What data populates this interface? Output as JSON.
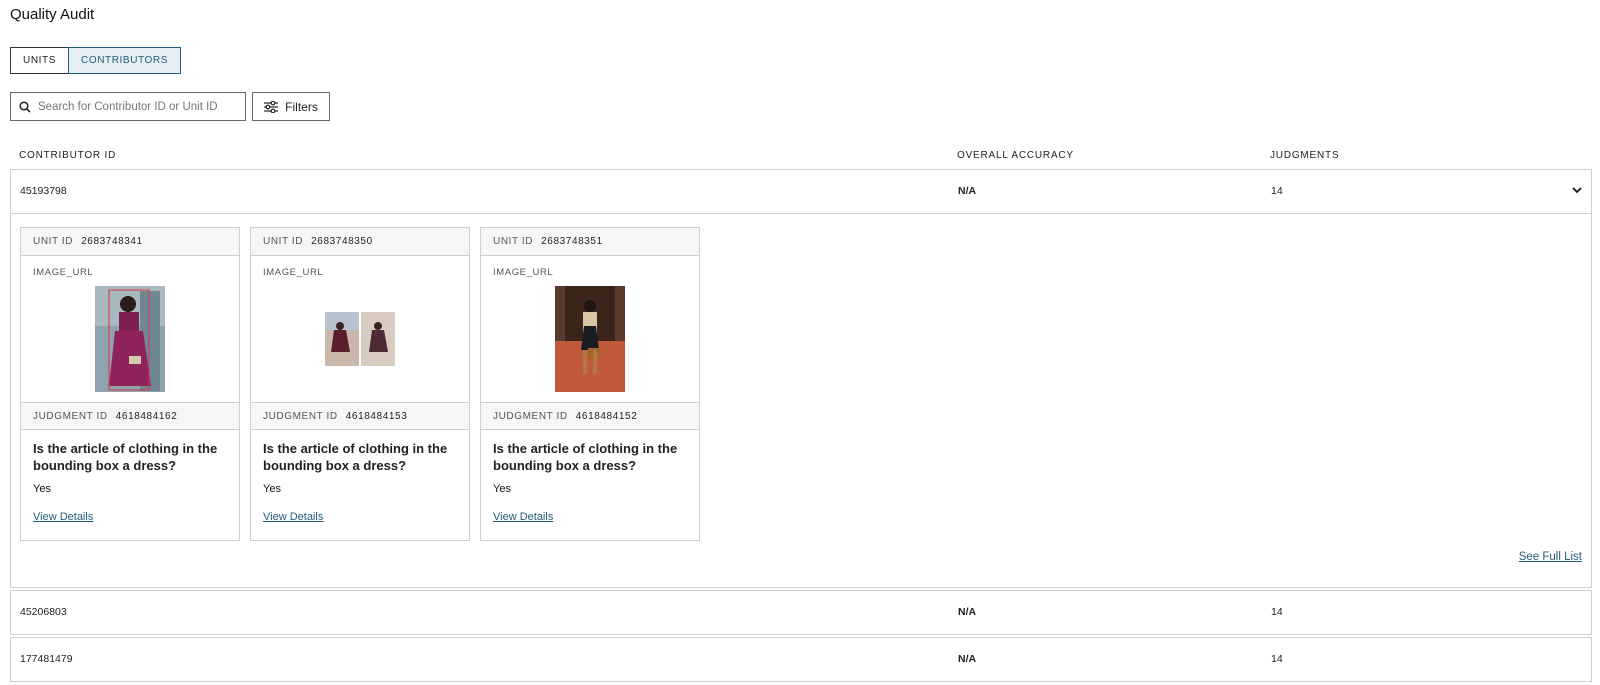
{
  "page": {
    "title": "Quality Audit"
  },
  "tabs": [
    {
      "label": "UNITS",
      "active": false
    },
    {
      "label": "CONTRIBUTORS",
      "active": true
    }
  ],
  "search": {
    "placeholder": "Search for Contributor ID or Unit ID",
    "icon": "search-icon"
  },
  "filters": {
    "label": "Filters",
    "icon": "sliders-icon"
  },
  "table": {
    "headers": {
      "contributor_id": "CONTRIBUTOR ID",
      "accuracy": "OVERALL ACCURACY",
      "judgments": "JUDGMENTS"
    },
    "rows": [
      {
        "contributor_id": "45193798",
        "accuracy": "N/A",
        "judgments": "14",
        "expanded": true
      },
      {
        "contributor_id": "45206803",
        "accuracy": "N/A",
        "judgments": "14",
        "expanded": false
      },
      {
        "contributor_id": "177481479",
        "accuracy": "N/A",
        "judgments": "14",
        "expanded": false
      }
    ]
  },
  "expanded_panel": {
    "unit_label": "UNIT ID",
    "image_field_label": "IMAGE_URL",
    "judgment_label": "JUDGMENT ID",
    "see_full_list": "See Full List",
    "cards": [
      {
        "unit_id": "2683748341",
        "judgment_id": "4618484162",
        "question": "Is the article of clothing in the bounding box a dress?",
        "answer": "Yes",
        "link": "View Details"
      },
      {
        "unit_id": "2683748350",
        "judgment_id": "4618484153",
        "question": "Is the article of clothing in the bounding box a dress?",
        "answer": "Yes",
        "link": "View Details"
      },
      {
        "unit_id": "2683748351",
        "judgment_id": "4618484152",
        "question": "Is the article of clothing in the bounding box a dress?",
        "answer": "Yes",
        "link": "View Details"
      }
    ]
  },
  "colors": {
    "accent": "#1f5b7a",
    "tab_active_bg": "#e6eff4",
    "border": "#cfcfcf",
    "card_header_bg": "#f5f6f8"
  }
}
